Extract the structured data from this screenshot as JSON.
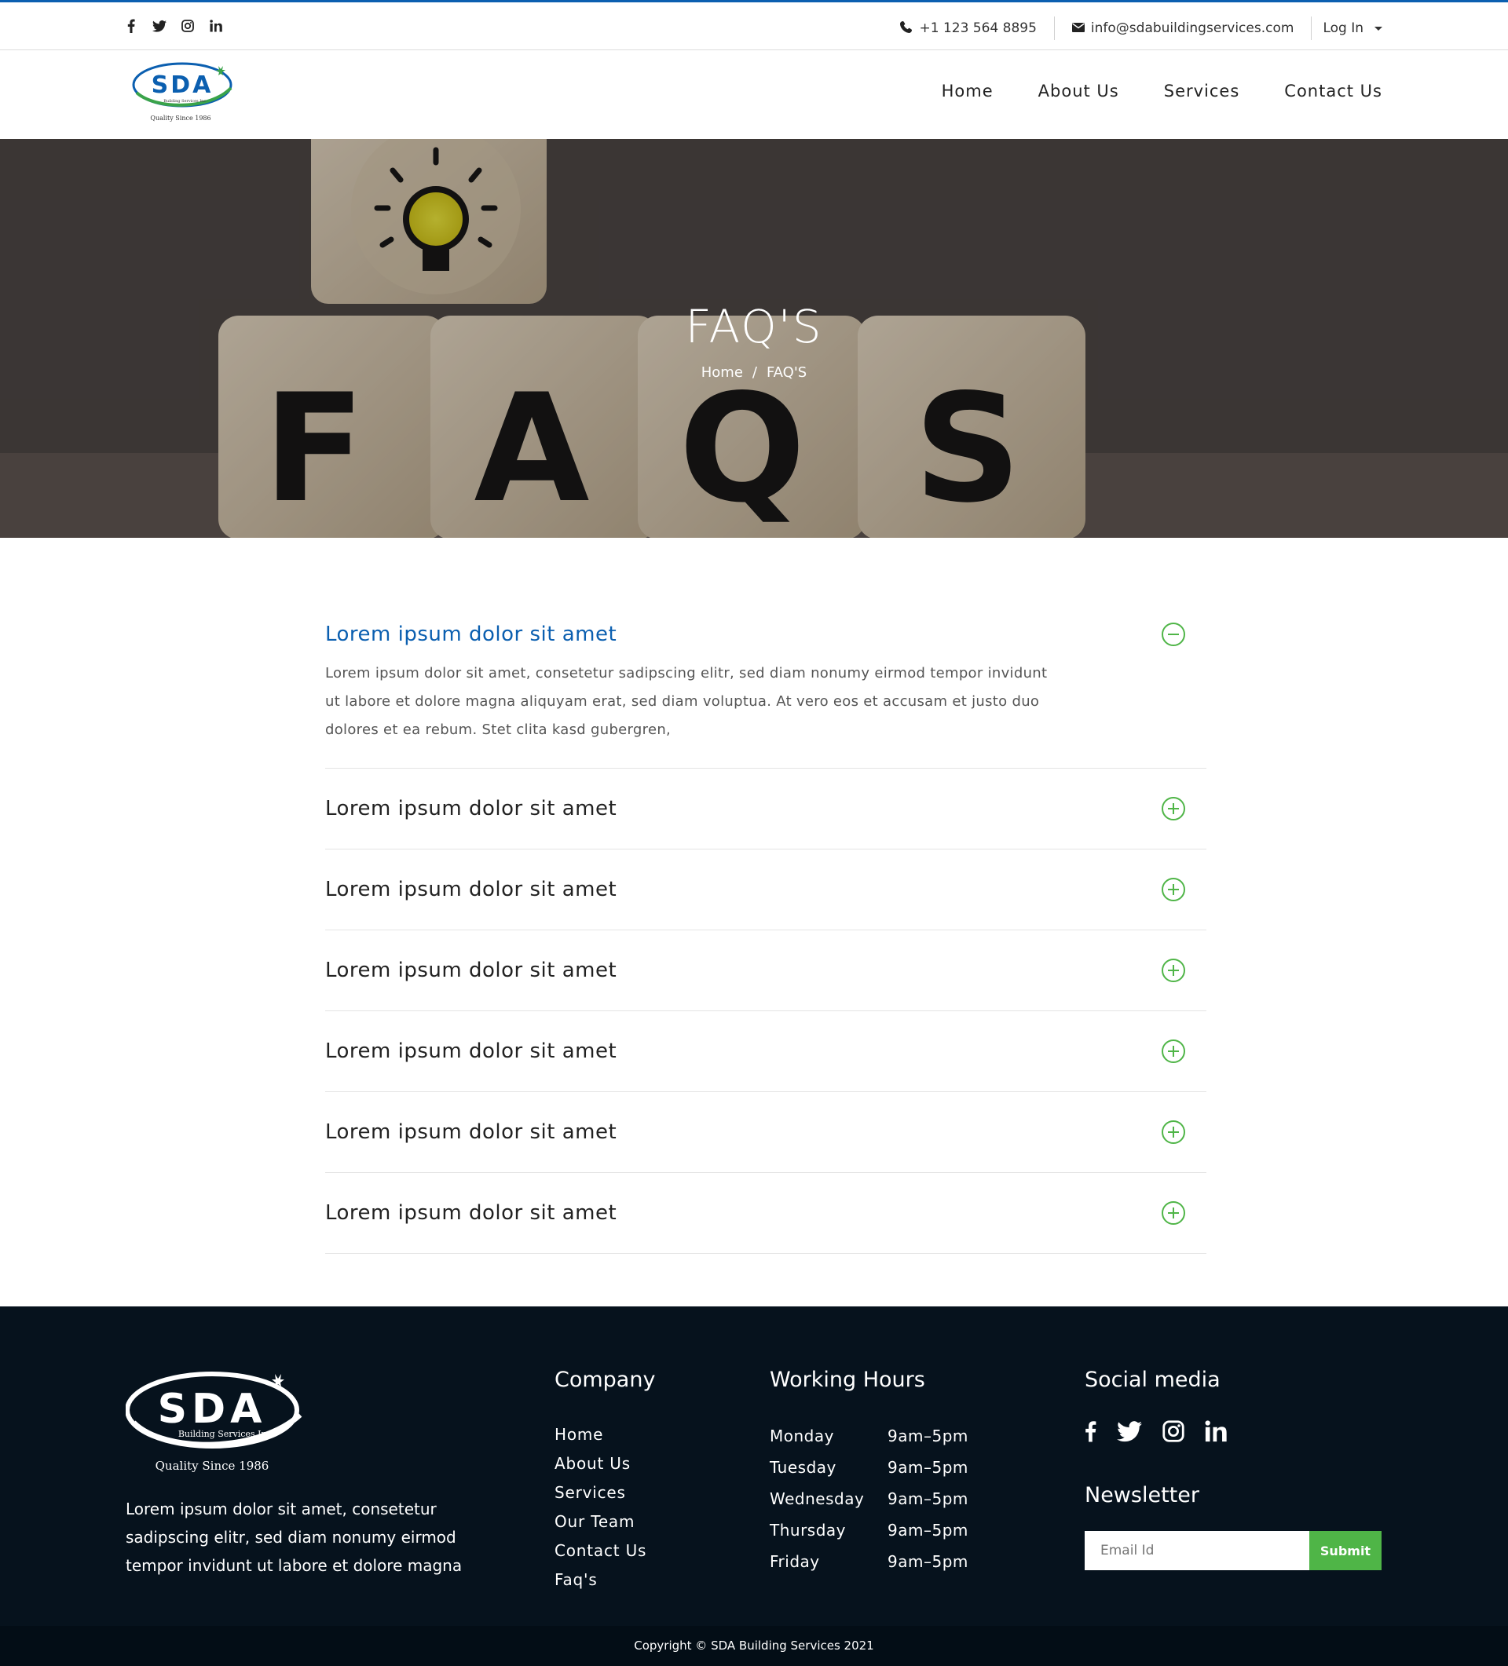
{
  "topbar": {
    "social_icons": [
      "facebook-icon",
      "twitter-icon",
      "instagram-icon",
      "linkedin-icon"
    ],
    "phone": "+1 123 564 8895",
    "email": "info@sdabuildingservices.com",
    "login_label": "Log In"
  },
  "header": {
    "logo_text": "SDA",
    "logo_sub": "Building Services Inc.",
    "logo_tagline": "Quality Since 1986",
    "nav": [
      "Home",
      "About Us",
      "Services",
      "Contact Us"
    ]
  },
  "hero": {
    "title": "FAQ'S",
    "breadcrumb_home": "Home",
    "breadcrumb_sep": "/",
    "breadcrumb_current": "FAQ'S",
    "dice_letters": [
      "F",
      "A",
      "Q",
      "S"
    ]
  },
  "faq": {
    "items": [
      {
        "question": "Lorem ipsum dolor sit amet",
        "answer": "Lorem ipsum dolor sit amet, consetetur sadipscing elitr, sed diam nonumy eirmod tempor invidunt ut labore et dolore magna aliquyam erat, sed diam voluptua. At vero eos et accusam et justo duo dolores et ea rebum. Stet clita kasd gubergren,",
        "open": true
      },
      {
        "question": "Lorem ipsum dolor sit amet",
        "open": false
      },
      {
        "question": "Lorem ipsum dolor sit amet",
        "open": false
      },
      {
        "question": "Lorem ipsum dolor sit amet",
        "open": false
      },
      {
        "question": "Lorem ipsum dolor sit amet",
        "open": false
      },
      {
        "question": "Lorem ipsum dolor sit amet",
        "open": false
      },
      {
        "question": "Lorem ipsum dolor sit amet",
        "open": false
      }
    ]
  },
  "footer": {
    "logo_text": "SDA",
    "logo_sub": "Building Services Inc.",
    "logo_tagline": "Quality Since 1986",
    "description": "Lorem ipsum dolor sit amet, consetetur sadipscing elitr, sed diam nonumy eirmod tempor invidunt ut labore et dolore magna",
    "company_title": "Company",
    "company_links": [
      "Home",
      "About Us",
      "Services",
      "Our Team",
      "Contact Us",
      "Faq's"
    ],
    "hours_title": "Working Hours",
    "hours": [
      {
        "day": "Monday",
        "time": "9am–5pm"
      },
      {
        "day": "Tuesday",
        "time": "9am–5pm"
      },
      {
        "day": "Wednesday",
        "time": "9am–5pm"
      },
      {
        "day": "Thursday",
        "time": "9am–5pm"
      },
      {
        "day": "Friday",
        "time": "9am–5pm"
      }
    ],
    "social_title": "Social media",
    "newsletter_title": "Newsletter",
    "email_placeholder": "Email Id",
    "submit_label": "Submit",
    "copyright": "Copyright © SDA Building Services 2021"
  },
  "colors": {
    "brand_blue": "#0b5fb0",
    "accent_green": "#4fb547",
    "footer_bg": "#06121d"
  }
}
